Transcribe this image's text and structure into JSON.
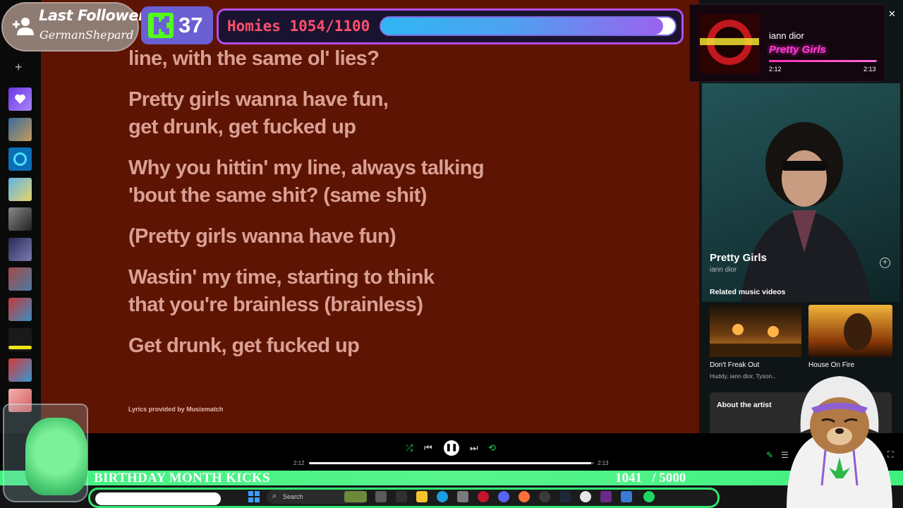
{
  "lyrics": {
    "lines": [
      "line, with the same ol' lies?",
      "Pretty girls wanna have fun,",
      "get drunk, get fucked up",
      "Why you hittin' my line, always talking",
      "'bout the same shit? (same shit)",
      "(Pretty girls wanna have fun)",
      "Wastin' my time, starting to think",
      "that you're brainless (brainless)",
      "Get drunk, get fucked up"
    ],
    "credit": "Lyrics provided by Musixmatch"
  },
  "now_playing_panel": {
    "song_title": "Pretty Girls",
    "artist": "iann dior",
    "related_heading": "Related music videos",
    "related": [
      {
        "title": "Don't Freak Out",
        "subtitle": "Huddy, iann dior, Tyson..."
      },
      {
        "title": "House On Fire",
        "subtitle": ""
      }
    ],
    "about_label": "About the artist"
  },
  "player": {
    "current_time": "2:12",
    "total_time": "2:13",
    "progress_fraction": 0.99,
    "controls": [
      "shuffle",
      "previous",
      "pause",
      "next",
      "repeat"
    ]
  },
  "overlays": {
    "follower_title": "Last Follower",
    "follower_name": "GermanShepard",
    "kick_count": "37",
    "homies_label": "Homies 1054/1100",
    "homies_current": 1054,
    "homies_goal": 1100,
    "np_artist": "iann dior",
    "np_song": "Pretty Girls",
    "np_current": "2:12",
    "np_total": "2:13",
    "np_progress_fraction": 0.99
  },
  "goal_bar": {
    "label": "BIRTHDAY MONTH KICKS",
    "count": "1041   / 5000",
    "current": 1041,
    "goal": 5000
  },
  "taskbar": {
    "search_label": "Search"
  },
  "colors": {
    "lyrics_bg": "#5e1402",
    "lyric_text": "#d9a094",
    "goal_green": "#3ff07e",
    "homies_border": "#b24ef2",
    "np_pink": "#ff3ad2"
  }
}
